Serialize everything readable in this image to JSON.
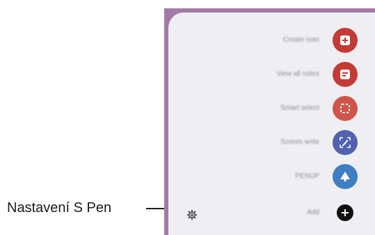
{
  "callout": {
    "label": "Nastavení S Pen"
  },
  "menu": {
    "items": [
      {
        "label": "Create note",
        "icon": "create-note-icon",
        "color": "#c33b35"
      },
      {
        "label": "View all notes",
        "icon": "view-notes-icon",
        "color": "#c33b35"
      },
      {
        "label": "Smart select",
        "icon": "smart-select-icon",
        "color": "#d0544a"
      },
      {
        "label": "Screen write",
        "icon": "screen-write-icon",
        "color": "#5062b0"
      },
      {
        "label": "PENUP",
        "icon": "penup-icon",
        "color": "#3f7ec2"
      },
      {
        "label": "Add",
        "icon": "add-icon",
        "color": "#111111"
      }
    ],
    "settings_icon": "gear-icon"
  },
  "colors": {
    "panel_border": "#a37aa7",
    "panel_bg": "#efeef2"
  }
}
